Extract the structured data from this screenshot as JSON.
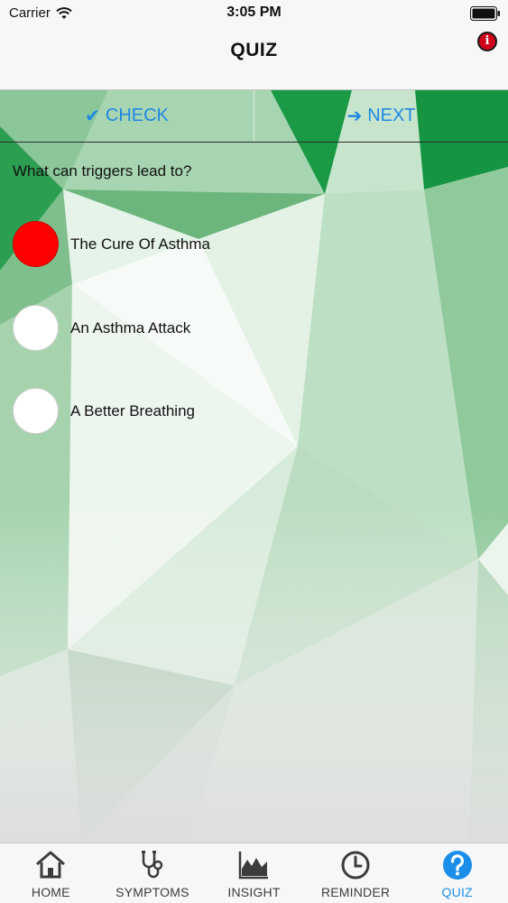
{
  "status_bar": {
    "carrier": "Carrier",
    "time": "3:05 PM",
    "wifi_icon": "wifi-icon",
    "battery_icon": "battery-icon"
  },
  "nav_bar": {
    "title": "QUIZ",
    "info_icon": "info-icon",
    "info_glyph": "i"
  },
  "actions": {
    "check_label": "CHECK",
    "check_icon": "checkmark-icon",
    "next_label": "NEXT",
    "next_icon": "arrow-right-icon",
    "color": "#1e88e5"
  },
  "quiz": {
    "question": "What can triggers lead to?",
    "options": [
      {
        "label": "The Cure Of Asthma",
        "selected": true
      },
      {
        "label": "An Asthma Attack",
        "selected": false
      },
      {
        "label": "A Better Breathing",
        "selected": false
      }
    ],
    "selected_color": "#ff0000"
  },
  "tab_bar": {
    "tabs": [
      {
        "label": "HOME",
        "icon": "home-icon",
        "active": false
      },
      {
        "label": "SYMPTOMS",
        "icon": "stethoscope-icon",
        "active": false
      },
      {
        "label": "INSIGHT",
        "icon": "chart-icon",
        "active": false
      },
      {
        "label": "REMINDER",
        "icon": "clock-icon",
        "active": false
      },
      {
        "label": "QUIZ",
        "icon": "question-icon",
        "active": true
      }
    ],
    "active_color": "#1a8ee8"
  }
}
